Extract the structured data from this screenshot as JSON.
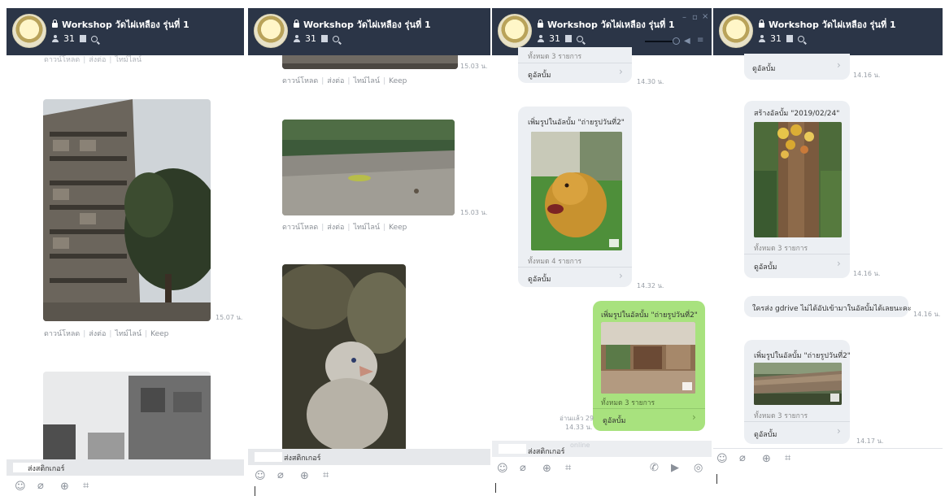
{
  "chat": {
    "title": "Workshop วัดไผ่เหลือง รุ่นที่ 1",
    "member_count": "31"
  },
  "actions": {
    "download": "ดาวน์โหลด",
    "forward": "ส่งต่อ",
    "timeline": "ไทม์ไลน์",
    "keep": "Keep"
  },
  "input": {
    "sticker_label": "ส่งสติกเกอร์",
    "faded_text": "online"
  },
  "panel1": {
    "time_photo1": "15.07 น."
  },
  "panel2": {
    "time_photo1": "15.03 น.",
    "time_photo2": "15.03 น."
  },
  "panel3": {
    "top_count": "ทั้งหมด 3 รายการ",
    "top_album": "ดูอัลบั้ม",
    "top_time": "14.30 น.",
    "msg1_text": "เพิ่มรูปในอัลบั้ม \"ถ่ายรูปวันที่2\"",
    "msg1_count": "ทั้งหมด 4 รายการ",
    "msg1_album": "ดูอัลบั้ม",
    "msg1_time": "14.32 น.",
    "msg2_text": "เพิ่มรูปในอัลบั้ม \"ถ่ายรูปวันที่2\"",
    "msg2_count": "ทั้งหมด 3 รายการ",
    "msg2_album": "ดูอัลบั้ม",
    "msg2_read": "อ่านแล้ว 29",
    "msg2_time": "14.33 น."
  },
  "panel4": {
    "top_album": "ดูอัลบั้ม",
    "top_time": "14.16 น.",
    "msg1_text": "สร้างอัลบั้ม \"2019/02/24\"",
    "msg1_count": "ทั้งหมด 3 รายการ",
    "msg1_album": "ดูอัลบั้ม",
    "msg1_time": "14.16 น.",
    "msg2_text": "ใครส่ง gdrive ไม่ได้อัปเข้ามาในอัลบั้มได้เลยนะคะ",
    "msg2_time": "14.16 น.",
    "msg3_text": "เพิ่มรูปในอัลบั้ม \"ถ่ายรูปวันที่2\"",
    "msg3_count": "ทั้งหมด 3 รายการ",
    "msg3_album": "ดูอัลบั้ม",
    "msg3_time": "14.17 น."
  },
  "colors": {
    "header": "#2b3547",
    "own_bubble": "#a8e27e",
    "other_bubble": "#eceff3"
  }
}
